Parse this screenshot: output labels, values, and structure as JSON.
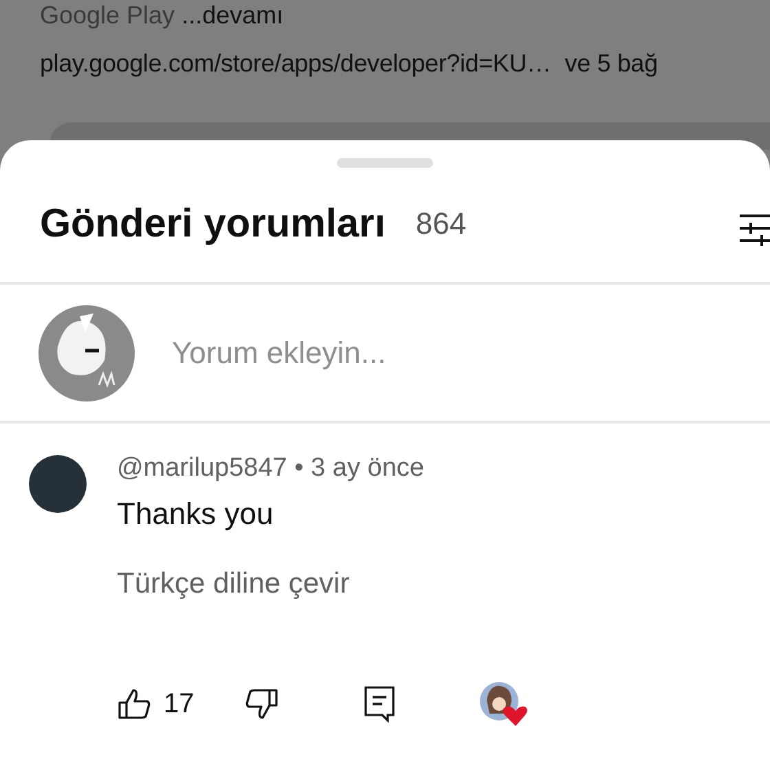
{
  "background_post": {
    "description_tail": "Google Play",
    "more_link": "...devamı",
    "link": "play.google.com/store/apps/developer?id=KU…",
    "more_links": "ve 5 bağ"
  },
  "sheet": {
    "title": "Gönderi yorumları",
    "count": "864",
    "comment_field": {
      "placeholder": "Yorum ekleyin..."
    },
    "comments": [
      {
        "meta": "@marilup5847 • 3 ay önce",
        "text": "Thanks you",
        "translate": "Türkçe diline çevir",
        "likes": "17",
        "creator_hearted": true
      }
    ]
  }
}
